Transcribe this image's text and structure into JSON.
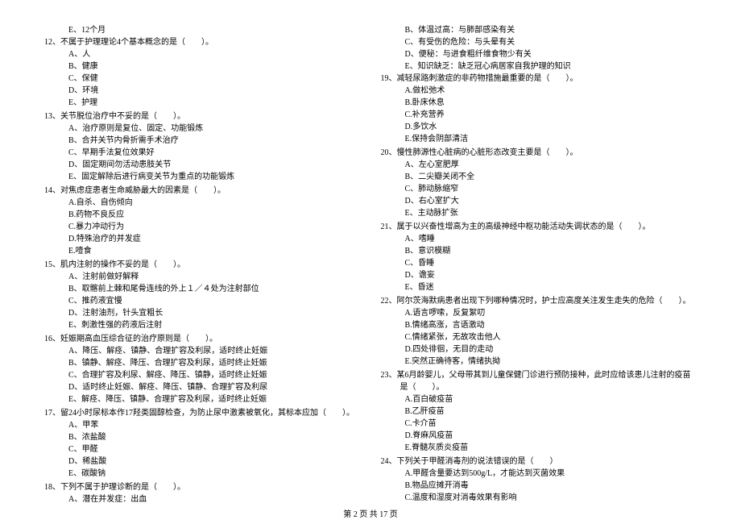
{
  "footer": "第 2 页 共 17 页",
  "left_column": [
    {
      "type": "option",
      "letter": "E、",
      "text": "12个月"
    },
    {
      "type": "question",
      "num": "12、",
      "text": "不属于护理理论4个基本概念的是（　　）。",
      "options": [
        {
          "letter": "A、",
          "text": "人"
        },
        {
          "letter": "B、",
          "text": "健康"
        },
        {
          "letter": "C、",
          "text": "保健"
        },
        {
          "letter": "D、",
          "text": "环境"
        },
        {
          "letter": "E、",
          "text": "护理"
        }
      ]
    },
    {
      "type": "question",
      "num": "13、",
      "text": "关节脱位治疗中不妥的是（　　）。",
      "options": [
        {
          "letter": "A、",
          "text": "治疗原则是复位、固定、功能锻炼"
        },
        {
          "letter": "B、",
          "text": "合并关节内骨折需手术治疗"
        },
        {
          "letter": "C、",
          "text": "早期手法复位效果好"
        },
        {
          "letter": "D、",
          "text": "固定期间勿活动患肢关节"
        },
        {
          "letter": "E、",
          "text": "固定解除后进行病变关节为重点的功能锻炼"
        }
      ]
    },
    {
      "type": "question",
      "num": "14、",
      "text": "对焦虑症患者生命威胁最大的因素是（　　）。",
      "options": [
        {
          "letter": "A.",
          "text": "自杀、自伤倾向"
        },
        {
          "letter": "B.",
          "text": "药物不良反应"
        },
        {
          "letter": "C.",
          "text": "暴力冲动行为"
        },
        {
          "letter": "D.",
          "text": "特殊治疗的并发症"
        },
        {
          "letter": "E.",
          "text": "噎食"
        }
      ]
    },
    {
      "type": "question",
      "num": "15、",
      "text": "肌内注射的操作不妥的是（　　）。",
      "options": [
        {
          "letter": "A、",
          "text": "注射前做好解释"
        },
        {
          "letter": "B、",
          "text": "取髂前上棘和尾骨连线的外上１／４处为注射部位"
        },
        {
          "letter": "C、",
          "text": "推药液宜慢"
        },
        {
          "letter": "D、",
          "text": "注射油剂，针头宜粗长"
        },
        {
          "letter": "E、",
          "text": "刺激性强的药液后注射"
        }
      ]
    },
    {
      "type": "question",
      "num": "16、",
      "text": "妊娠期高血压综合征的治疗原则是（　　）。",
      "options": [
        {
          "letter": "A、",
          "text": "降压、解痉、镇静、合理扩容及利尿，适时终止妊娠"
        },
        {
          "letter": "B、",
          "text": "镇静、解痉、降压、合理扩容及利尿，适时终止妊娠"
        },
        {
          "letter": "C、",
          "text": "合理扩容及利尿、解痉、降压、镇静，适时终止妊娠"
        },
        {
          "letter": "D、",
          "text": "适时终止妊娠、解痉、降压、镇静、合理扩容及利尿"
        },
        {
          "letter": "E、",
          "text": "解痉、降压、镇静、合理扩容及利尿，适时终止妊娠"
        }
      ]
    },
    {
      "type": "question",
      "num": "17、",
      "text": "留24小时尿标本作17羟类固醇检查，为防止尿中激素被氧化，其标本应加（　　）。",
      "options": [
        {
          "letter": "A、",
          "text": "甲苯"
        },
        {
          "letter": "B、",
          "text": "浓盐酸"
        },
        {
          "letter": "C、",
          "text": "甲醛"
        },
        {
          "letter": "D、",
          "text": "稀盐酸"
        },
        {
          "letter": "E、",
          "text": "碳酸钠"
        }
      ]
    },
    {
      "type": "question",
      "num": "18、",
      "text": "下列不属于护理诊断的是（　　）。",
      "options": [
        {
          "letter": "A、",
          "text": "潜在并发症：出血"
        }
      ]
    }
  ],
  "right_column": [
    {
      "type": "option_list",
      "options": [
        {
          "letter": "B、",
          "text": "体温过高：与肺部感染有关"
        },
        {
          "letter": "C、",
          "text": "有受伤的危险：与头晕有关"
        },
        {
          "letter": "D、",
          "text": "便秘：与进食粗纤维食物少有关"
        },
        {
          "letter": "E、",
          "text": "知识缺乏：缺乏冠心病居家自我护理的知识"
        }
      ]
    },
    {
      "type": "question",
      "num": "19、",
      "text": "减轻尿路刺激症的非药物措施最重要的是（　　）。",
      "options": [
        {
          "letter": "A.",
          "text": "做松弛术"
        },
        {
          "letter": "B.",
          "text": "卧床休息"
        },
        {
          "letter": "C.",
          "text": "补充营养"
        },
        {
          "letter": "D.",
          "text": "多饮水"
        },
        {
          "letter": "E.",
          "text": "保持会阴部清洁"
        }
      ]
    },
    {
      "type": "question",
      "num": "20、",
      "text": "慢性肺源性心脏病的心脏形态改变主要是（　　）。",
      "options": [
        {
          "letter": "A、",
          "text": "左心室肥厚"
        },
        {
          "letter": "B、",
          "text": "二尖瓣关闭不全"
        },
        {
          "letter": "C、",
          "text": "肺动脉缩窄"
        },
        {
          "letter": "D、",
          "text": "右心室扩大"
        },
        {
          "letter": "E、",
          "text": "主动脉扩张"
        }
      ]
    },
    {
      "type": "question",
      "num": "21、",
      "text": "属于以兴奋性增高为主的高级神经中枢功能活动失调状态的是（　　）。",
      "options": [
        {
          "letter": "A、",
          "text": "嗜睡"
        },
        {
          "letter": "B、",
          "text": "意识模糊"
        },
        {
          "letter": "C、",
          "text": "昏睡"
        },
        {
          "letter": "D、",
          "text": "谵妄"
        },
        {
          "letter": "E、",
          "text": "昏迷"
        }
      ]
    },
    {
      "type": "question",
      "num": "22、",
      "text": "阿尔茨海默病患者出现下列哪种情况时，护士应高度关注发生走失的危险（　　）。",
      "options": [
        {
          "letter": "A.",
          "text": "语言啰嗦，反复絮叨"
        },
        {
          "letter": "B.",
          "text": "情绪高涨，言语激动"
        },
        {
          "letter": "C.",
          "text": "情绪紧张，无故攻击他人"
        },
        {
          "letter": "D.",
          "text": "四处徘徊，无目的走动"
        },
        {
          "letter": "E.",
          "text": "突然正确待客，情绪执拗"
        }
      ]
    },
    {
      "type": "question",
      "num": "23、",
      "text": "某6月龄婴儿，父母带其到儿童保健门诊进行预防接种，此时应给该患儿注射的疫苗是（　　）。",
      "options": [
        {
          "letter": "A.",
          "text": "百白破疫苗"
        },
        {
          "letter": "B.",
          "text": "乙肝疫苗"
        },
        {
          "letter": "C.",
          "text": "卡介苗"
        },
        {
          "letter": "D.",
          "text": "脊麻风疫苗"
        },
        {
          "letter": "E.",
          "text": "脊髓灰质炎疫苗"
        }
      ]
    },
    {
      "type": "question",
      "num": "24、",
      "text": "下列关于甲醛消毒剂的说法错误的是（　　）",
      "options": [
        {
          "letter": "A.",
          "text": "甲醛含量要达到500g/L，才能达到灭菌效果"
        },
        {
          "letter": "B.",
          "text": "物品应摊开消毒"
        },
        {
          "letter": "C.",
          "text": "温度和湿度对消毒效果有影响"
        }
      ]
    }
  ]
}
